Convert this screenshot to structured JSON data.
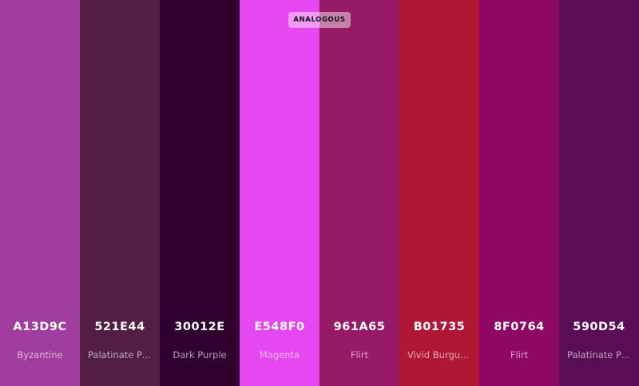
{
  "palette_type": "ANALOGOUS",
  "colors": [
    {
      "hex": "A13D9C",
      "name": "Byzantine",
      "color": "#A13D9C"
    },
    {
      "hex": "521E44",
      "name": "Palatinate Purple",
      "color": "#521E44"
    },
    {
      "hex": "30012E",
      "name": "Dark Purple",
      "color": "#30012E"
    },
    {
      "hex": "E548F0",
      "name": "Magenta",
      "color": "#E548F0"
    },
    {
      "hex": "961A65",
      "name": "Flirt",
      "color": "#961A65"
    },
    {
      "hex": "B01735",
      "name": "Vivid Burgundy",
      "color": "#B01735"
    },
    {
      "hex": "8F0764",
      "name": "Flirt",
      "color": "#8F0764"
    },
    {
      "hex": "590D54",
      "name": "Palatinate Purple",
      "color": "#590D54"
    }
  ]
}
